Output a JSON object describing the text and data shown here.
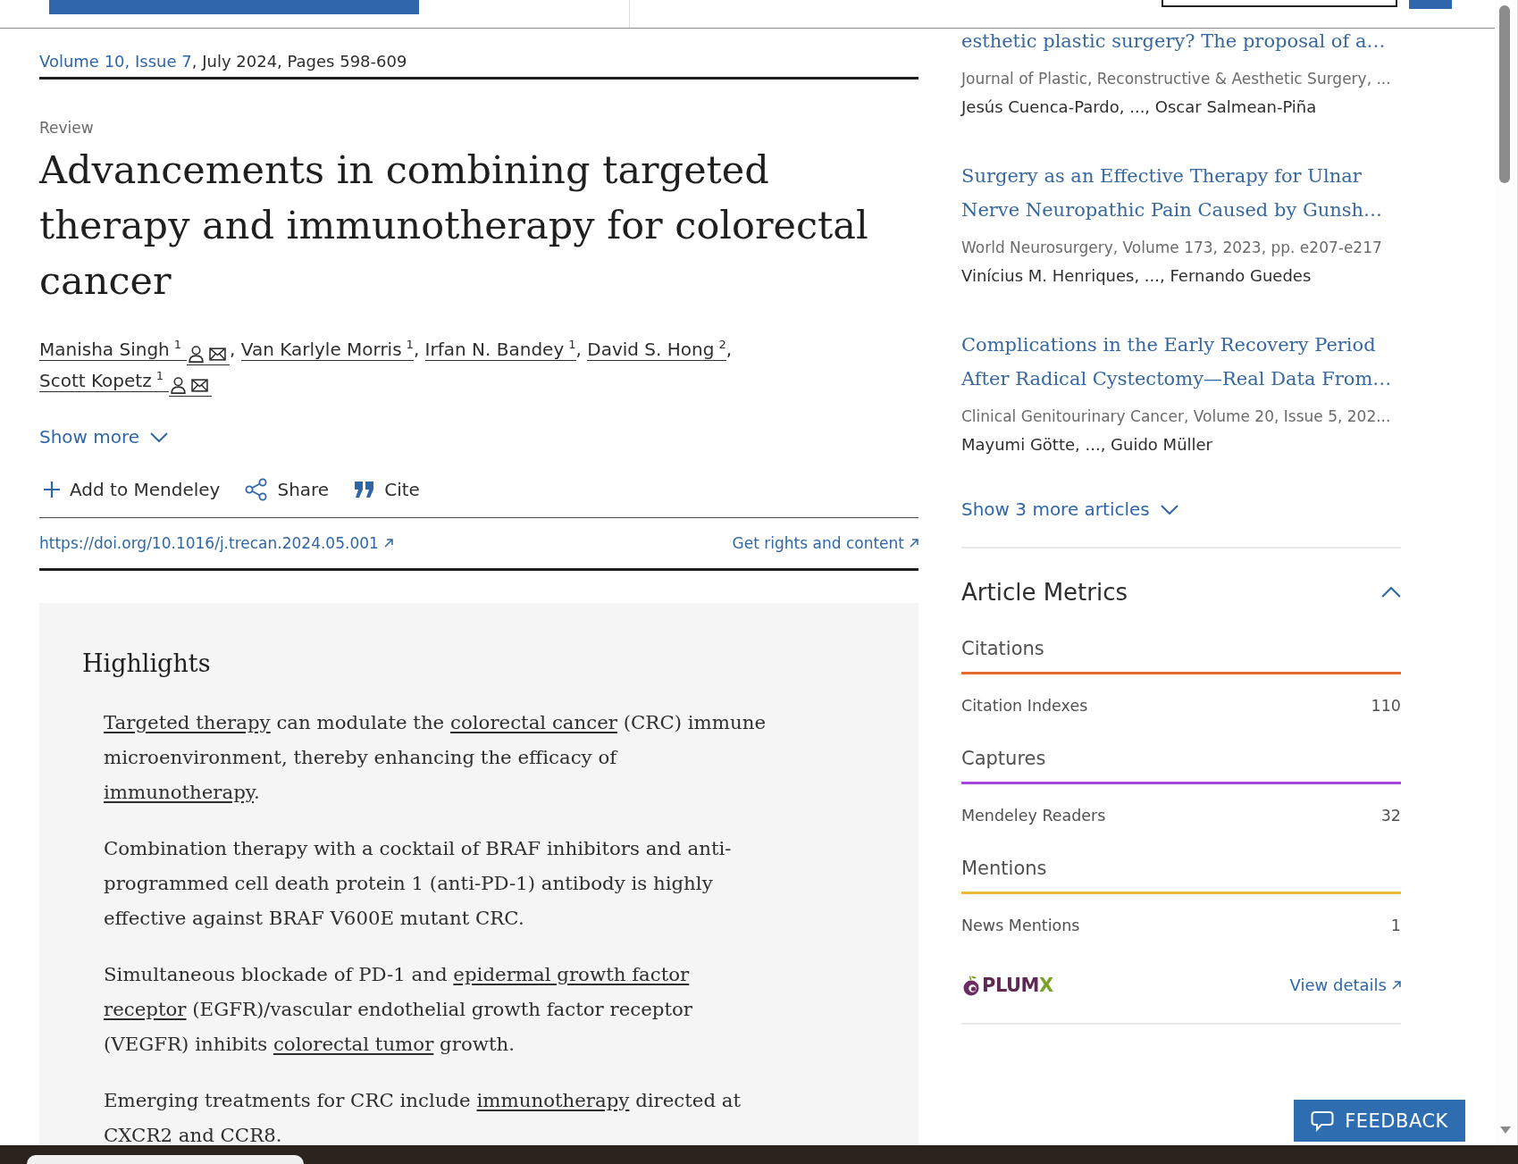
{
  "citation": {
    "issue_link": "Volume 10, Issue 7",
    "details": ", July 2024, Pages 598-609"
  },
  "article": {
    "type": "Review",
    "title": "Advancements in combining targeted therapy and immunotherapy for colorectal cancer",
    "authors": [
      {
        "name": "Manisha Singh",
        "affiliation": "1",
        "corresponding": true,
        "separator": ","
      },
      {
        "name": "Van Karlyle Morris",
        "affiliation": "1",
        "corresponding": false,
        "separator": ","
      },
      {
        "name": "Irfan N. Bandey",
        "affiliation": "1",
        "corresponding": false,
        "separator": ","
      },
      {
        "name": "David S. Hong",
        "affiliation": "2",
        "corresponding": false,
        "separator": ","
      },
      {
        "name": "Scott Kopetz",
        "affiliation": "1",
        "corresponding": true
      }
    ],
    "show_more": "Show more",
    "actions": [
      {
        "kind": "add",
        "label": "Add to Mendeley"
      },
      {
        "kind": "share",
        "label": "Share"
      },
      {
        "kind": "cite",
        "label": "Cite"
      }
    ],
    "doi": "https://doi.org/10.1016/j.trecan.2024.05.001",
    "rights_link": "Get rights and content"
  },
  "highlights": {
    "heading": "Highlights",
    "items": [
      {
        "segments": [
          {
            "text": "Targeted therapy",
            "link": true
          },
          {
            "text": " can modulate the ",
            "link": false
          },
          {
            "text": "colorectal cancer",
            "link": true
          },
          {
            "text": " (CRC) immune microenvironment, thereby enhancing the efficacy of ",
            "link": false
          },
          {
            "text": "immunotherapy",
            "link": true
          },
          {
            "text": ".",
            "link": false
          }
        ]
      },
      {
        "segments": [
          {
            "text": "Combination therapy with a cocktail of BRAF inhibitors and anti-programmed cell death protein 1 (anti-PD-1) antibody is highly effective against BRAF V600E mutant CRC.",
            "link": false
          }
        ]
      },
      {
        "segments": [
          {
            "text": "Simultaneous blockade of PD-1 and ",
            "link": false
          },
          {
            "text": "epidermal growth factor ",
            "link": true
          },
          {
            "text": "receptor",
            "link": true
          },
          {
            "text": " (EGFR)/vascular endothelial growth factor receptor (VEGFR) inhibits ",
            "link": false
          },
          {
            "text": "colorectal tumor",
            "link": true
          },
          {
            "text": " growth.",
            "link": false
          }
        ]
      },
      {
        "segments": [
          {
            "text": "Emerging treatments for CRC include ",
            "link": false
          },
          {
            "text": "immunotherapy",
            "link": true
          },
          {
            "text": " directed at CXCR2 and CCR8.",
            "link": false
          }
        ]
      }
    ]
  },
  "recommended_articles": {
    "items": [
      {
        "title": "esthetic plastic surgery? The proposal of a…",
        "journal": "Journal of Plastic, Reconstructive & Aesthetic Surgery, ...",
        "authors": "Jesús Cuenca-Pardo, ..., Oscar Salmean-Piña"
      },
      {
        "title": "Surgery as an Effective Therapy for Ulnar Nerve Neuropathic Pain Caused by Gunsh…",
        "journal": "World Neurosurgery, Volume 173, 2023, pp. e207-e217",
        "authors": "Vinícius M. Henriques, ..., Fernando Guedes"
      },
      {
        "title": "Complications in the Early Recovery Period After Radical Cystectomy—Real Data From…",
        "journal": "Clinical Genitourinary Cancer, Volume 20, Issue 5, 202...",
        "authors": "Mayumi Götte, ..., Guido Müller"
      }
    ],
    "show_more": "Show 3 more articles"
  },
  "article_metrics": {
    "title": "Article Metrics",
    "expanded": true,
    "groups": [
      {
        "label": "Citations",
        "color": "#e3692e",
        "items": [
          {
            "label": "Citation Indexes",
            "value": "110"
          }
        ]
      },
      {
        "label": "Captures",
        "color": "#a445df",
        "items": [
          {
            "label": "Mendeley Readers",
            "value": "32"
          }
        ]
      },
      {
        "label": "Mentions",
        "color": "#e8bb3b",
        "items": [
          {
            "label": "News Mentions",
            "value": "1"
          }
        ]
      }
    ],
    "logo_text": "PLUMX",
    "details_link": "View details"
  },
  "feedback_button": "FEEDBACK"
}
